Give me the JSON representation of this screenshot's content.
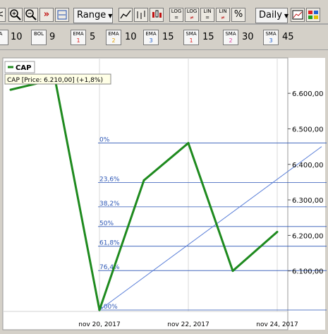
{
  "toolbar": {
    "range_label": "Range",
    "period_label": "Daily",
    "log_label": "LOG",
    "lin_label": "LIN",
    "percent_label": "%"
  },
  "indicators": [
    {
      "name": "A",
      "value": "10"
    },
    {
      "name": "BOL",
      "value": "9"
    },
    {
      "name": "EMA",
      "sub": "1",
      "sub_color": "#e02020",
      "value": "5"
    },
    {
      "name": "EMA",
      "sub": "2",
      "sub_color": "#e0a000",
      "value": "10"
    },
    {
      "name": "EMA",
      "sub": "3",
      "sub_color": "#2060d0",
      "value": "15"
    },
    {
      "name": "SMA",
      "sub": "1",
      "sub_color": "#e02020",
      "value": "15"
    },
    {
      "name": "SMA",
      "sub": "2",
      "sub_color": "#e040a0",
      "value": "30"
    },
    {
      "name": "SMA",
      "sub": "3",
      "sub_color": "#2060d0",
      "value": "45"
    }
  ],
  "chart_data": {
    "type": "line",
    "legend_label": "CAP",
    "tooltip": "CAP [Price: 6.210,00] (+1,8%)",
    "series": [
      {
        "name": "CAP",
        "color": "#1e8a1e",
        "x": [
          "nov 16, 2017",
          "nov 17, 2017",
          "nov 20, 2017",
          "nov 21, 2017",
          "nov 22, 2017",
          "nov 23, 2017",
          "nov 24, 2017"
        ],
        "values": [
          6610,
          6640,
          5990,
          6355,
          6460,
          6100,
          6210
        ]
      }
    ],
    "x_ticks": [
      "nov 20, 2017",
      "nov 22, 2017",
      "nov 24, 2017"
    ],
    "y_ticks": [
      "6.100,00",
      "6.200,00",
      "6.300,00",
      "6.400,00",
      "6.500,00",
      "6.600,00"
    ],
    "y_tick_values": [
      6100,
      6200,
      6300,
      6400,
      6500,
      6600
    ],
    "ylim": [
      5990,
      6680
    ],
    "fibonacci": {
      "levels": [
        "0%",
        "23,6%",
        "38,2%",
        "50%",
        "61,8%",
        "76,4%",
        "100%"
      ],
      "color": "#2a55b5",
      "high": 6460,
      "low": 5990
    },
    "trendline": {
      "color": "#5a7fd8",
      "from": [
        2,
        5990
      ],
      "to": [
        7,
        6450
      ]
    }
  }
}
